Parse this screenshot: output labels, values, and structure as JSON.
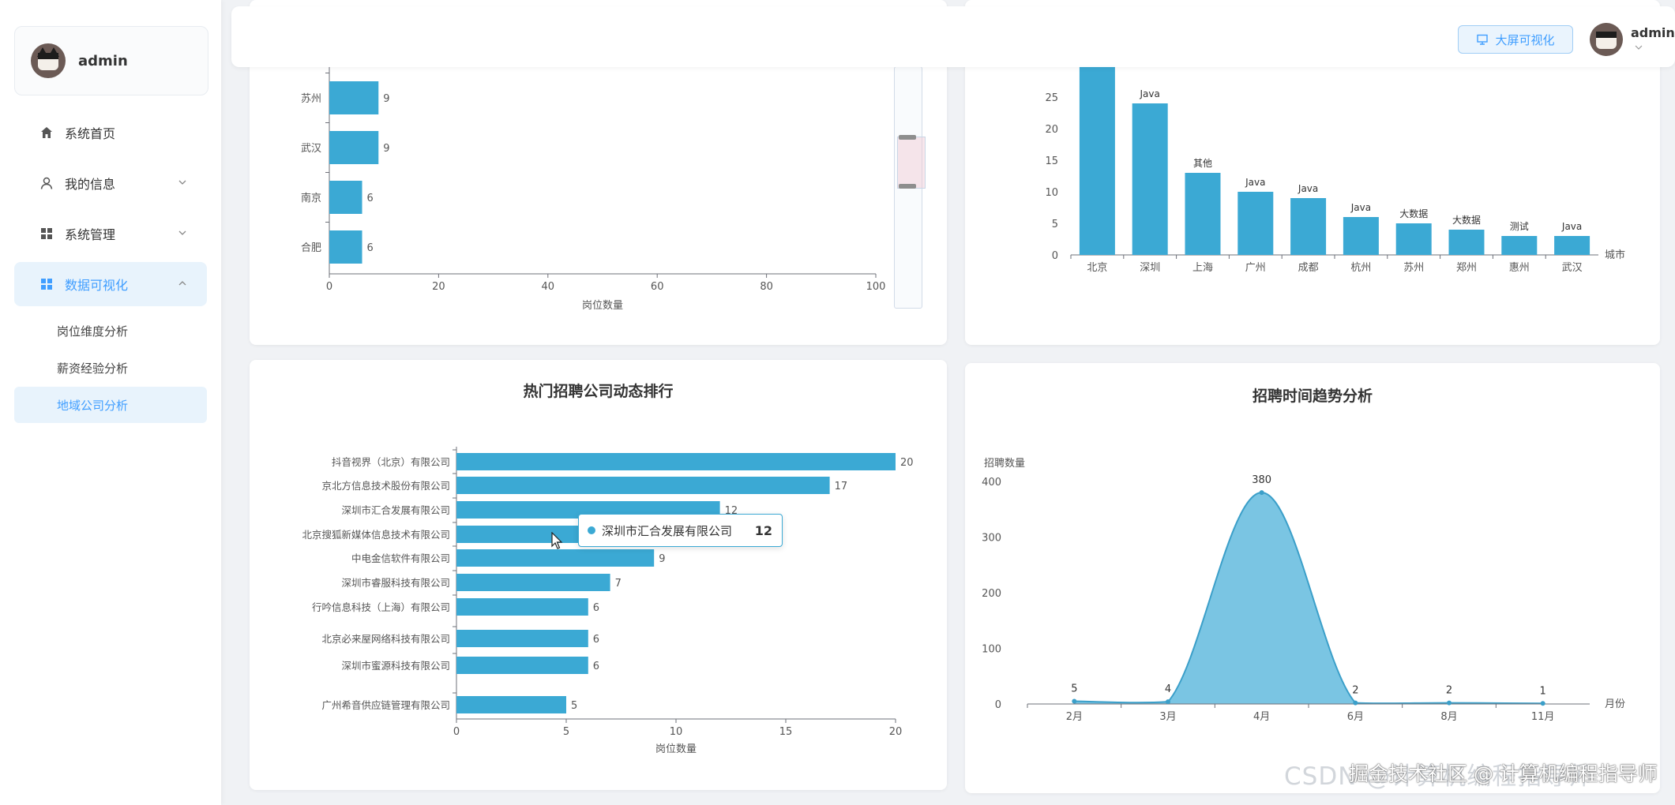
{
  "sidebar": {
    "user": {
      "name": "admin"
    },
    "menu": [
      {
        "label": "系统首页",
        "icon": "home-icon"
      },
      {
        "label": "我的信息",
        "icon": "user-icon",
        "expandable": true
      },
      {
        "label": "系统管理",
        "icon": "grid-icon",
        "expandable": true
      },
      {
        "label": "数据可视化",
        "icon": "grid-icon",
        "expandable": true,
        "expanded": true,
        "active": true
      }
    ],
    "submenu": [
      {
        "label": "岗位维度分析"
      },
      {
        "label": "薪资经验分析"
      },
      {
        "label": "地域公司分析",
        "active": true
      }
    ]
  },
  "header": {
    "big_screen_label": "大屏可视化",
    "user_name": "admin"
  },
  "colors": {
    "accent": "#409eff",
    "bar": "#3ba9d4",
    "area": "#6bbfe0"
  },
  "chart_data": [
    {
      "id": "city-jobs",
      "type": "bar",
      "orientation": "horizontal",
      "categories": [
        "苏州",
        "武汉",
        "南京",
        "合肥"
      ],
      "values": [
        9,
        9,
        6,
        6
      ],
      "xlabel": "岗位数量",
      "xlim": [
        0,
        100
      ],
      "xticks": [
        0,
        20,
        40,
        60,
        80,
        100
      ]
    },
    {
      "id": "city-top-position",
      "type": "bar",
      "categories": [
        "北京",
        "深圳",
        "上海",
        "广州",
        "成都",
        "杭州",
        "苏州",
        "郑州",
        "惠州",
        "武汉"
      ],
      "values": [
        30,
        24,
        13,
        10,
        9,
        6,
        5,
        4,
        3,
        3
      ],
      "labels": [
        "",
        "Java",
        "其他",
        "Java",
        "Java",
        "Java",
        "大数据",
        "大数据",
        "测试",
        "Java"
      ],
      "xlabel": "城市",
      "ylim": [
        0,
        30
      ],
      "yticks": [
        0,
        5,
        10,
        15,
        20,
        25
      ]
    },
    {
      "id": "company-ranking",
      "type": "bar",
      "orientation": "horizontal",
      "title": "热门招聘公司动态排行",
      "categories": [
        "抖音视界（北京）有限公司",
        "京北方信息技术股份有限公司",
        "深圳市汇合发展有限公司",
        "北京搜狐新媒体信息技术有限公司",
        "中电金信软件有限公司",
        "深圳市睿服科技有限公司",
        "行吟信息科技（上海）有限公司",
        "北京必来屋网络科技有限公司",
        "深圳市蜜源科技有限公司",
        "广州希音供应链管理有限公司"
      ],
      "values": [
        20,
        17,
        12,
        12,
        9,
        7,
        6,
        6,
        6,
        5
      ],
      "xlabel": "岗位数量",
      "xlim": [
        0,
        20
      ],
      "xticks": [
        0,
        5,
        10,
        15,
        20
      ],
      "tooltip": {
        "label": "深圳市汇合发展有限公司",
        "value": "12"
      }
    },
    {
      "id": "hiring-trend",
      "type": "area",
      "title": "招聘时间趋势分析",
      "x": [
        "2月",
        "3月",
        "4月",
        "6月",
        "8月",
        "11月"
      ],
      "values": [
        5,
        4,
        380,
        2,
        2,
        1
      ],
      "ylabel": "招聘数量",
      "xlabel": "月份",
      "ylim": [
        0,
        400
      ],
      "yticks": [
        0,
        100,
        200,
        300,
        400
      ]
    }
  ],
  "watermark": {
    "csdn": "CSDN @计算机编程指导师",
    "juejin": "掘金技术社区 @ 计算机编程指导师"
  }
}
